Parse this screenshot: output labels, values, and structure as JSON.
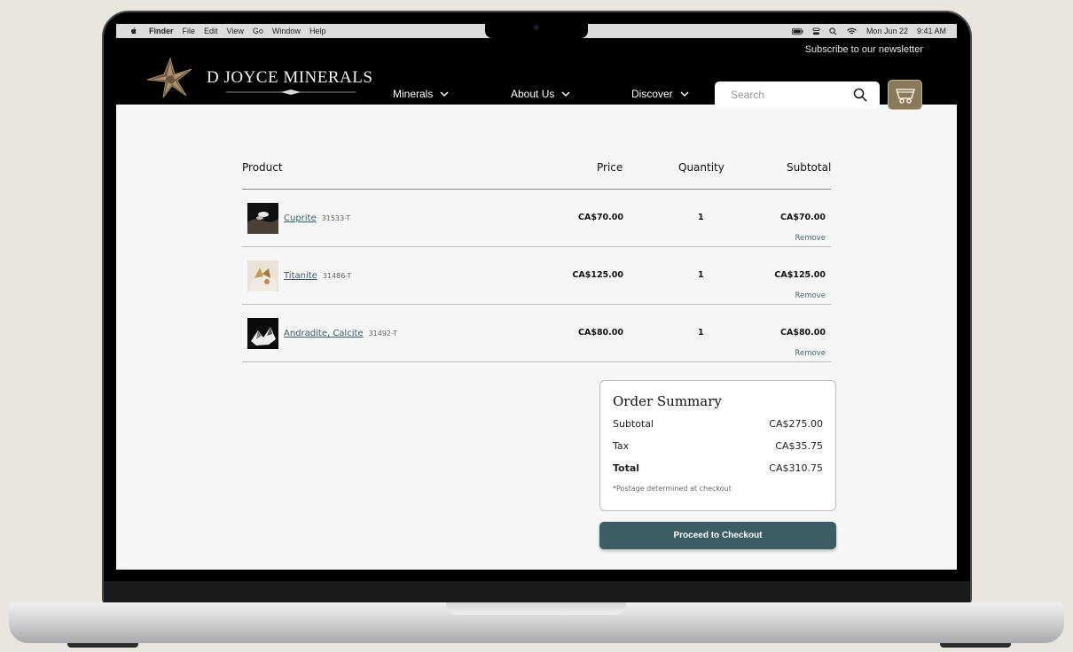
{
  "macos": {
    "menu": [
      "Finder",
      "File",
      "Edit",
      "View",
      "Go",
      "Window",
      "Help"
    ],
    "clock_date": "Mon Jun 22",
    "clock_time": "9:41 AM"
  },
  "site": {
    "newsletter": "Subscribe to our newsletter",
    "logo_text": "D JOYCE MINERALS",
    "nav": [
      {
        "label": "Minerals"
      },
      {
        "label": "About Us"
      },
      {
        "label": "Discover"
      }
    ],
    "search_placeholder": "Search"
  },
  "cart": {
    "headers": {
      "product": "Product",
      "price": "Price",
      "quantity": "Quantity",
      "subtotal": "Subtotal"
    },
    "items": [
      {
        "name": "Cuprite",
        "sku": "31533-T",
        "price": "CA$70.00",
        "qty": "1",
        "subtotal": "CA$70.00",
        "remove": "Remove"
      },
      {
        "name": "Titanite",
        "sku": "31486-T",
        "price": "CA$125.00",
        "qty": "1",
        "subtotal": "CA$125.00",
        "remove": "Remove"
      },
      {
        "name": "Andradite, Calcite",
        "sku": "31492-T",
        "price": "CA$80.00",
        "qty": "1",
        "subtotal": "CA$80.00",
        "remove": "Remove"
      }
    ]
  },
  "summary": {
    "title": "Order Summary",
    "subtotal_label": "Subtotal",
    "subtotal_value": "CA$275.00",
    "tax_label": "Tax",
    "tax_value": "CA$35.75",
    "total_label": "Total",
    "total_value": "CA$310.75",
    "postage_note": "*Postage determined at checkout",
    "checkout_label": "Proceed to Checkout"
  },
  "colors": {
    "accent": "#3c5d63",
    "header_bg": "#000000",
    "cart_button_bg": "#8a7a5c",
    "page_bg": "#f6f6f6"
  },
  "icons": [
    "apple-icon",
    "battery-icon",
    "control-center-icon",
    "spotlight-icon",
    "wifi-icon",
    "chevron-down-icon",
    "search-icon",
    "cart-icon"
  ]
}
